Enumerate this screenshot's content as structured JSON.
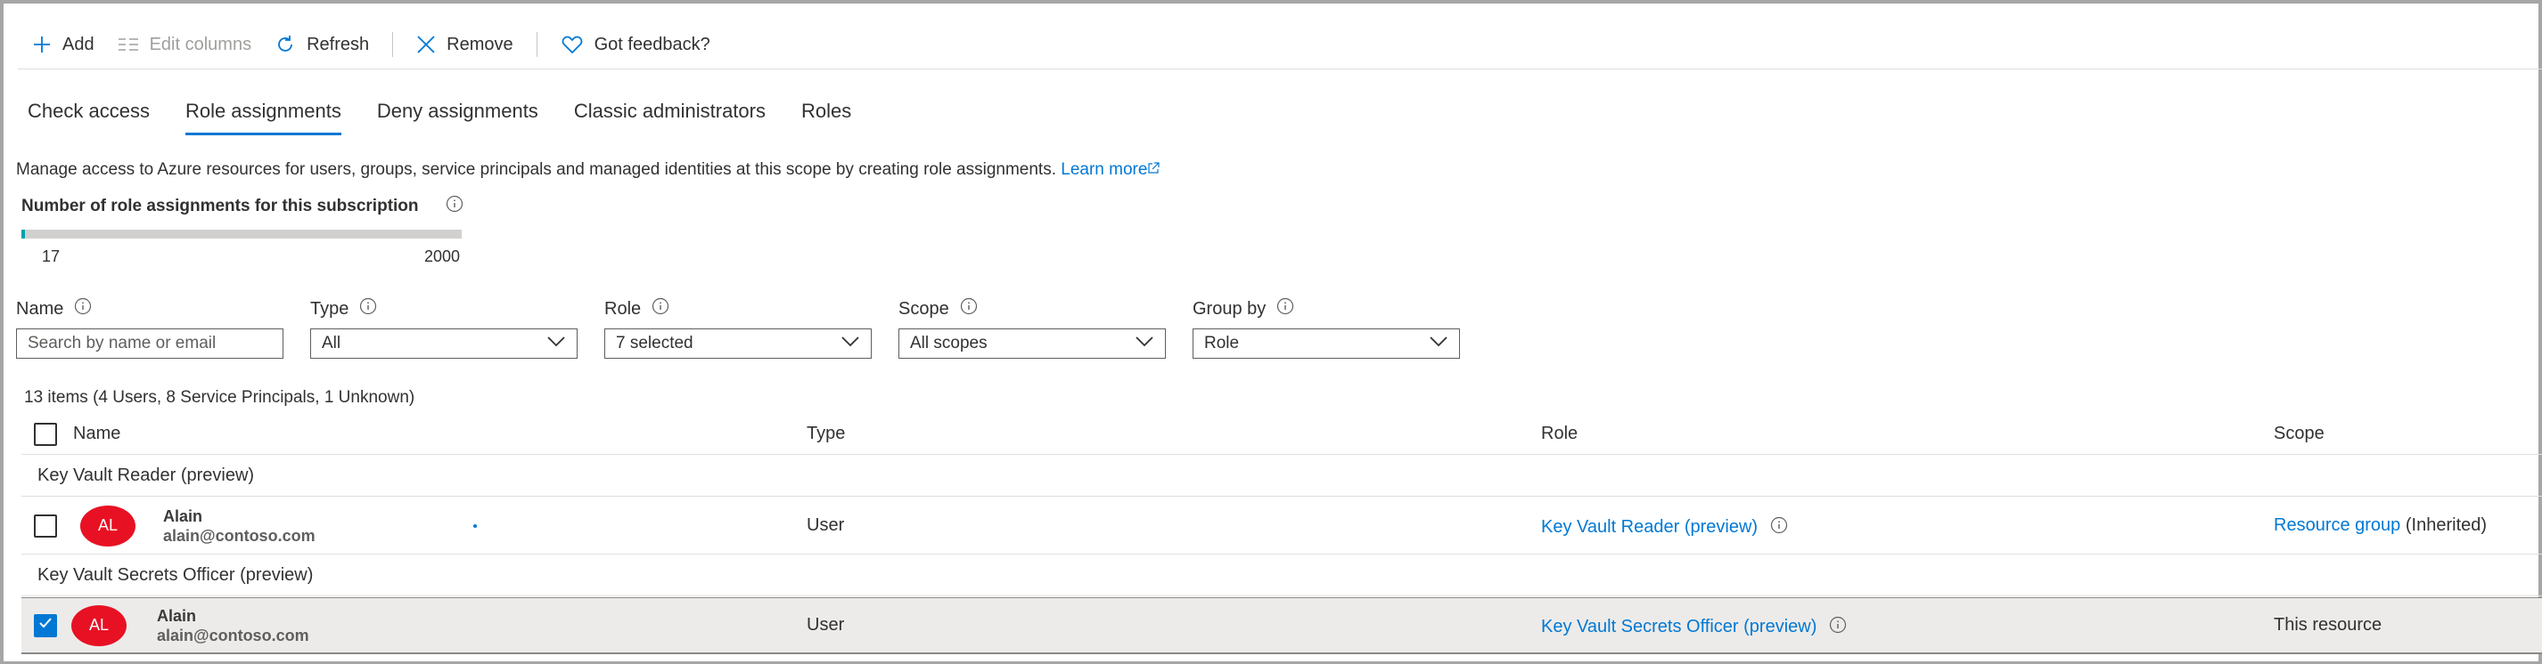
{
  "toolbar": {
    "add": "Add",
    "edit_columns": "Edit columns",
    "refresh": "Refresh",
    "remove": "Remove",
    "feedback": "Got feedback?"
  },
  "tabs": [
    "Check access",
    "Role assignments",
    "Deny assignments",
    "Classic administrators",
    "Roles"
  ],
  "active_tab": "Role assignments",
  "description": {
    "text": "Manage access to Azure resources for users, groups, service principals and managed identities at this scope by creating role assignments.",
    "link": "Learn more"
  },
  "quota": {
    "title": "Number of role assignments for this subscription",
    "current": "17",
    "max": "2000",
    "fill_fraction": 0.0085
  },
  "filters": {
    "name": {
      "label": "Name",
      "placeholder": "Search by name or email",
      "value": ""
    },
    "type": {
      "label": "Type",
      "value": "All"
    },
    "role": {
      "label": "Role",
      "value": "7 selected"
    },
    "scope": {
      "label": "Scope",
      "value": "All scopes"
    },
    "group_by": {
      "label": "Group by",
      "value": "Role"
    }
  },
  "count_text": "13 items (4 Users, 8 Service Principals, 1 Unknown)",
  "columns": {
    "name": "Name",
    "type": "Type",
    "role": "Role",
    "scope": "Scope"
  },
  "groups": [
    {
      "title": "Key Vault Reader (preview)",
      "rows": [
        {
          "initials": "AL",
          "name": "Alain",
          "email": "alain@contoso.com",
          "type": "User",
          "role": "Key Vault Reader (preview)",
          "scope_link": "Resource group",
          "scope_suffix": "(Inherited)",
          "checked": false
        }
      ]
    },
    {
      "title": "Key Vault Secrets Officer (preview)",
      "rows": [
        {
          "initials": "AL",
          "name": "Alain",
          "email": "alain@contoso.com",
          "type": "User",
          "role": "Key Vault Secrets Officer (preview)",
          "scope_text": "This resource",
          "checked": true
        }
      ]
    }
  ],
  "colors": {
    "accent": "#0078d4",
    "avatar": "#e81123",
    "meter": "#00a2ad"
  }
}
